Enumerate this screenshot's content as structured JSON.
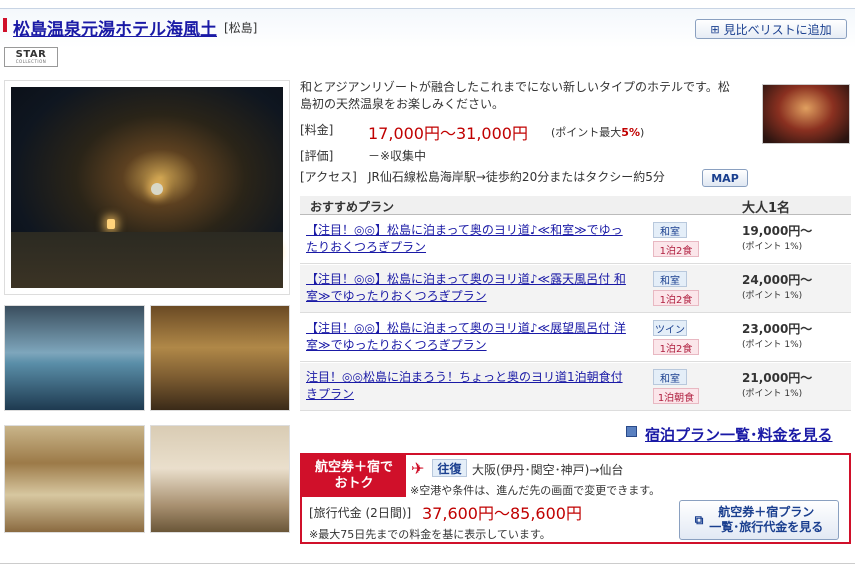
{
  "hotel": {
    "name": "松島温泉元湯ホテル海風土",
    "area": "[松島]",
    "compare_button": "見比べリストに追加",
    "logo_text": "STAR",
    "logo_sub": "COLLECTION",
    "description": "和とアジアンリゾートが融合したこれまでにない新しいタイプのホテルです。松島初の天然温泉をお楽しみください。",
    "price_label": "[料金]",
    "price": "17,000円〜31,000円",
    "point_prefix": "(ポイント最大",
    "point_value": "5%",
    "point_suffix": ")",
    "rating_label": "[評価]",
    "rating": "－※収集中",
    "access_label": "[アクセス]",
    "access": "JR仙石線松島海岸駅→徒歩約20分またはタクシー約5分",
    "map_button": "MAP"
  },
  "plans": {
    "header_left": "おすすめプラン",
    "header_right": "大人1名",
    "rows": [
      {
        "title": "【注目！◎◎】松島に泊まって奥のヨリ道♪≪和室≫でゆったりおくつろぎプラン",
        "room": "和室",
        "meal": "1泊2食",
        "price": "19,000円〜",
        "point": "(ポイント 1%)"
      },
      {
        "title": "【注目！◎◎】松島に泊まって奥のヨリ道♪≪露天風呂付 和室≫でゆったりおくつろぎプラン",
        "room": "和室",
        "meal": "1泊2食",
        "price": "24,000円〜",
        "point": "(ポイント 1%)"
      },
      {
        "title": "【注目！◎◎】松島に泊まって奥のヨリ道♪≪展望風呂付 洋室≫でゆったりおくつろぎプラン",
        "room": "ツイン",
        "meal": "1泊2食",
        "price": "23,000円〜",
        "point": "(ポイント 1%)"
      },
      {
        "title": "注目！◎◎松島に泊まろう！ちょっと奥のヨリ道1泊朝食付きプラン",
        "room": "和室",
        "meal": "1泊朝食",
        "price": "21,000円〜",
        "point": "(ポイント 1%)"
      }
    ],
    "list_link": "宿泊プラン一覧･料金を見る"
  },
  "air": {
    "title_line1": "航空券＋宿で",
    "title_line2": "おトク",
    "trip_type": "往復",
    "route": "大阪(伊丹･関空･神戸)→仙台",
    "note": "※空港や条件は、進んだ先の画面で変更できます。",
    "tour_label": "[旅行代金 (2日間)]",
    "tour_price": "37,600円〜85,600円",
    "tour_note": "※最大75日先までの料金を基に表示しています。",
    "button_line1": "航空券＋宿プラン",
    "button_line2": "一覧･旅行代金を見る"
  },
  "colors": {
    "accent_red": "#d0102a",
    "price_red": "#c00000",
    "link_blue": "#1a1aa6"
  }
}
